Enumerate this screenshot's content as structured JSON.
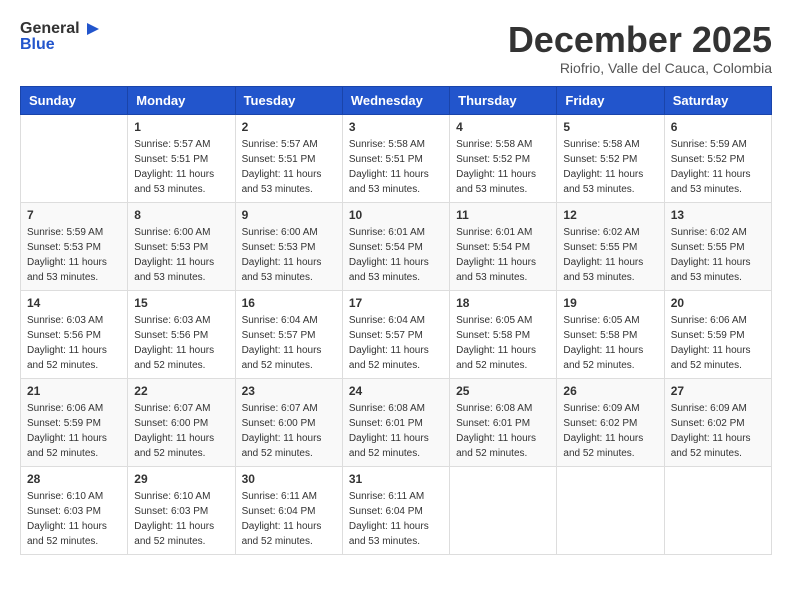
{
  "logo": {
    "general": "General",
    "blue": "Blue"
  },
  "header": {
    "month": "December 2025",
    "location": "Riofrio, Valle del Cauca, Colombia"
  },
  "days_of_week": [
    "Sunday",
    "Monday",
    "Tuesday",
    "Wednesday",
    "Thursday",
    "Friday",
    "Saturday"
  ],
  "weeks": [
    [
      {
        "day": "",
        "sunrise": "",
        "sunset": "",
        "daylight": ""
      },
      {
        "day": "1",
        "sunrise": "Sunrise: 5:57 AM",
        "sunset": "Sunset: 5:51 PM",
        "daylight": "Daylight: 11 hours and 53 minutes."
      },
      {
        "day": "2",
        "sunrise": "Sunrise: 5:57 AM",
        "sunset": "Sunset: 5:51 PM",
        "daylight": "Daylight: 11 hours and 53 minutes."
      },
      {
        "day": "3",
        "sunrise": "Sunrise: 5:58 AM",
        "sunset": "Sunset: 5:51 PM",
        "daylight": "Daylight: 11 hours and 53 minutes."
      },
      {
        "day": "4",
        "sunrise": "Sunrise: 5:58 AM",
        "sunset": "Sunset: 5:52 PM",
        "daylight": "Daylight: 11 hours and 53 minutes."
      },
      {
        "day": "5",
        "sunrise": "Sunrise: 5:58 AM",
        "sunset": "Sunset: 5:52 PM",
        "daylight": "Daylight: 11 hours and 53 minutes."
      },
      {
        "day": "6",
        "sunrise": "Sunrise: 5:59 AM",
        "sunset": "Sunset: 5:52 PM",
        "daylight": "Daylight: 11 hours and 53 minutes."
      }
    ],
    [
      {
        "day": "7",
        "sunrise": "Sunrise: 5:59 AM",
        "sunset": "Sunset: 5:53 PM",
        "daylight": "Daylight: 11 hours and 53 minutes."
      },
      {
        "day": "8",
        "sunrise": "Sunrise: 6:00 AM",
        "sunset": "Sunset: 5:53 PM",
        "daylight": "Daylight: 11 hours and 53 minutes."
      },
      {
        "day": "9",
        "sunrise": "Sunrise: 6:00 AM",
        "sunset": "Sunset: 5:53 PM",
        "daylight": "Daylight: 11 hours and 53 minutes."
      },
      {
        "day": "10",
        "sunrise": "Sunrise: 6:01 AM",
        "sunset": "Sunset: 5:54 PM",
        "daylight": "Daylight: 11 hours and 53 minutes."
      },
      {
        "day": "11",
        "sunrise": "Sunrise: 6:01 AM",
        "sunset": "Sunset: 5:54 PM",
        "daylight": "Daylight: 11 hours and 53 minutes."
      },
      {
        "day": "12",
        "sunrise": "Sunrise: 6:02 AM",
        "sunset": "Sunset: 5:55 PM",
        "daylight": "Daylight: 11 hours and 53 minutes."
      },
      {
        "day": "13",
        "sunrise": "Sunrise: 6:02 AM",
        "sunset": "Sunset: 5:55 PM",
        "daylight": "Daylight: 11 hours and 53 minutes."
      }
    ],
    [
      {
        "day": "14",
        "sunrise": "Sunrise: 6:03 AM",
        "sunset": "Sunset: 5:56 PM",
        "daylight": "Daylight: 11 hours and 52 minutes."
      },
      {
        "day": "15",
        "sunrise": "Sunrise: 6:03 AM",
        "sunset": "Sunset: 5:56 PM",
        "daylight": "Daylight: 11 hours and 52 minutes."
      },
      {
        "day": "16",
        "sunrise": "Sunrise: 6:04 AM",
        "sunset": "Sunset: 5:57 PM",
        "daylight": "Daylight: 11 hours and 52 minutes."
      },
      {
        "day": "17",
        "sunrise": "Sunrise: 6:04 AM",
        "sunset": "Sunset: 5:57 PM",
        "daylight": "Daylight: 11 hours and 52 minutes."
      },
      {
        "day": "18",
        "sunrise": "Sunrise: 6:05 AM",
        "sunset": "Sunset: 5:58 PM",
        "daylight": "Daylight: 11 hours and 52 minutes."
      },
      {
        "day": "19",
        "sunrise": "Sunrise: 6:05 AM",
        "sunset": "Sunset: 5:58 PM",
        "daylight": "Daylight: 11 hours and 52 minutes."
      },
      {
        "day": "20",
        "sunrise": "Sunrise: 6:06 AM",
        "sunset": "Sunset: 5:59 PM",
        "daylight": "Daylight: 11 hours and 52 minutes."
      }
    ],
    [
      {
        "day": "21",
        "sunrise": "Sunrise: 6:06 AM",
        "sunset": "Sunset: 5:59 PM",
        "daylight": "Daylight: 11 hours and 52 minutes."
      },
      {
        "day": "22",
        "sunrise": "Sunrise: 6:07 AM",
        "sunset": "Sunset: 6:00 PM",
        "daylight": "Daylight: 11 hours and 52 minutes."
      },
      {
        "day": "23",
        "sunrise": "Sunrise: 6:07 AM",
        "sunset": "Sunset: 6:00 PM",
        "daylight": "Daylight: 11 hours and 52 minutes."
      },
      {
        "day": "24",
        "sunrise": "Sunrise: 6:08 AM",
        "sunset": "Sunset: 6:01 PM",
        "daylight": "Daylight: 11 hours and 52 minutes."
      },
      {
        "day": "25",
        "sunrise": "Sunrise: 6:08 AM",
        "sunset": "Sunset: 6:01 PM",
        "daylight": "Daylight: 11 hours and 52 minutes."
      },
      {
        "day": "26",
        "sunrise": "Sunrise: 6:09 AM",
        "sunset": "Sunset: 6:02 PM",
        "daylight": "Daylight: 11 hours and 52 minutes."
      },
      {
        "day": "27",
        "sunrise": "Sunrise: 6:09 AM",
        "sunset": "Sunset: 6:02 PM",
        "daylight": "Daylight: 11 hours and 52 minutes."
      }
    ],
    [
      {
        "day": "28",
        "sunrise": "Sunrise: 6:10 AM",
        "sunset": "Sunset: 6:03 PM",
        "daylight": "Daylight: 11 hours and 52 minutes."
      },
      {
        "day": "29",
        "sunrise": "Sunrise: 6:10 AM",
        "sunset": "Sunset: 6:03 PM",
        "daylight": "Daylight: 11 hours and 52 minutes."
      },
      {
        "day": "30",
        "sunrise": "Sunrise: 6:11 AM",
        "sunset": "Sunset: 6:04 PM",
        "daylight": "Daylight: 11 hours and 52 minutes."
      },
      {
        "day": "31",
        "sunrise": "Sunrise: 6:11 AM",
        "sunset": "Sunset: 6:04 PM",
        "daylight": "Daylight: 11 hours and 53 minutes."
      },
      {
        "day": "",
        "sunrise": "",
        "sunset": "",
        "daylight": ""
      },
      {
        "day": "",
        "sunrise": "",
        "sunset": "",
        "daylight": ""
      },
      {
        "day": "",
        "sunrise": "",
        "sunset": "",
        "daylight": ""
      }
    ]
  ]
}
